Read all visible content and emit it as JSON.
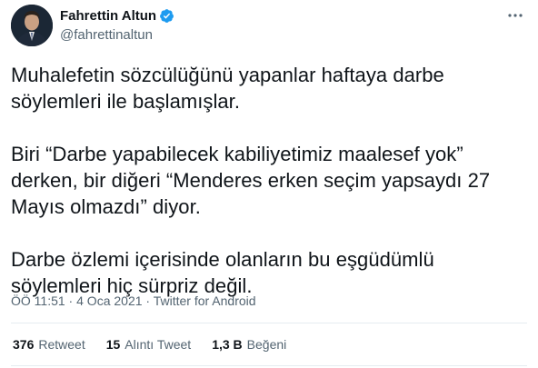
{
  "author": {
    "display_name": "Fahrettin Altun",
    "handle": "@fahrettinaltun",
    "verified": true
  },
  "tweet": {
    "paragraphs": [
      "Muhalefetin sözcülüğünü yapanlar haftaya darbe söylemleri ile başlamışlar.",
      "Biri “Darbe yapabilecek kabiliyetimiz maalesef yok” derken, bir diğeri “Menderes erken seçim yapsaydı 27 Mayıs olmazdı” diyor.",
      "Darbe özlemi içerisinde olanların bu eşgüdümlü söylemleri hiç sürpriz değil."
    ]
  },
  "meta": {
    "time": "ÖÖ 11:51",
    "separator": " · ",
    "date": "4 Oca 2021",
    "source": "Twitter for Android"
  },
  "stats": {
    "retweets": {
      "count": "376",
      "label": "Retweet"
    },
    "quotes": {
      "count": "15",
      "label": "Alıntı Tweet"
    },
    "likes": {
      "count": "1,3 B",
      "label": "Beğeni"
    }
  },
  "colors": {
    "text": "#0f1419",
    "secondary": "#536471",
    "verified": "#1d9bf0",
    "divider": "#e6ecf0"
  },
  "icons": {
    "verified": "verified-badge-icon",
    "more": "more-options-icon"
  }
}
